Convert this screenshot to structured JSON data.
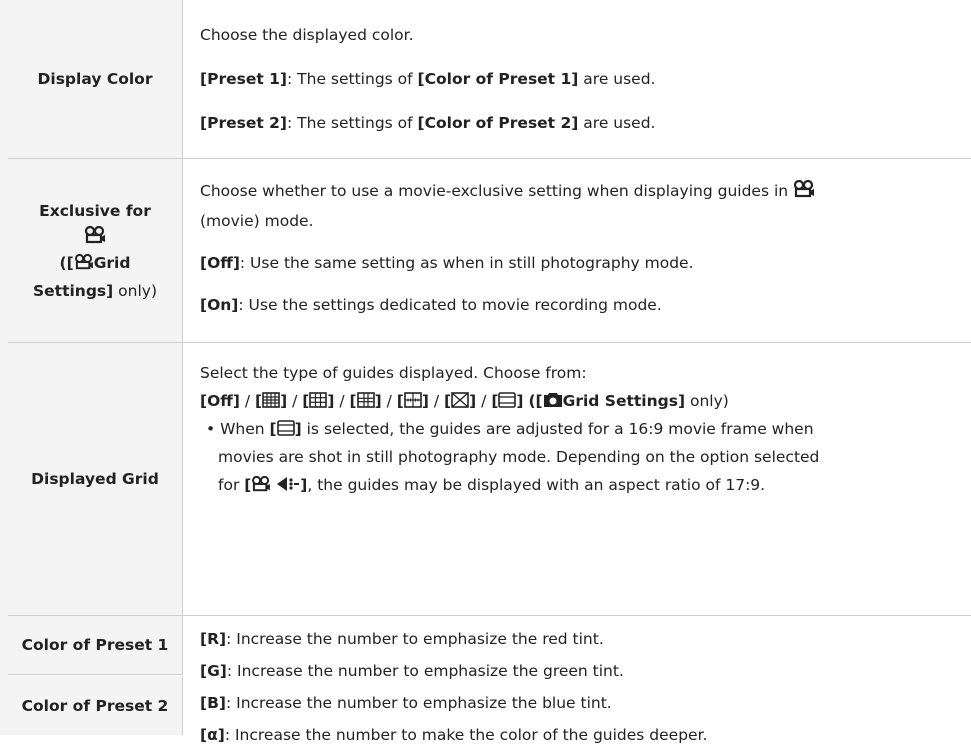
{
  "rows": {
    "display_color": {
      "label": "Display Color",
      "intro": "Choose the displayed color.",
      "opt1_key": "[Preset 1]",
      "opt1_mid": ": The settings of ",
      "opt1_ref": "[Color of Preset 1]",
      "opt1_end": " are used.",
      "opt2_key": "[Preset 2]",
      "opt2_mid": ": The settings of ",
      "opt2_ref": "[Color of Preset 2]",
      "opt2_end": " are used."
    },
    "exclusive": {
      "label_l1": "Exclusive for",
      "label_l3_pre": "([",
      "label_l3_bold": "Grid",
      "label_l4_bold": "Settings]",
      "label_l4_rest": " only)",
      "intro_l1": "Choose whether to use a movie-exclusive setting when displaying guides in",
      "intro_l2": "(movie) mode.",
      "off_key": "[Off]",
      "off_text": ": Use the same setting as when in still photography mode.",
      "on_key": "[On]",
      "on_text": ": Use the settings dedicated to movie recording mode."
    },
    "grid": {
      "label": "Displayed Grid",
      "intro": "Select the type of guides displayed. Choose from:",
      "off_key": "[Off]",
      "sep": " / ",
      "grid_settings": "Grid Settings]",
      "only": " only)",
      "bullet_pre": "When ",
      "bullet_post": " is selected, the guides are adjusted for a 16:9 movie frame when",
      "bullet_l2": "movies are shot in still photography mode. Depending on the option selected",
      "bullet_l3_pre": "for ",
      "bullet_l3_post": ", the guides may be displayed with an aspect ratio of 17:9."
    },
    "preset": {
      "label1": "Color of Preset 1",
      "label2": "Color of Preset 2",
      "r_key": "[R]",
      "r_text": ": Increase the number to emphasize the red tint.",
      "g_key": "[G]",
      "g_text": ": Increase the number to emphasize the green tint.",
      "b_key": "[B]",
      "b_text": ": Increase the number to emphasize the blue tint.",
      "a_key": "[α]",
      "a_text": ": Increase the number to make the color of the guides deeper."
    }
  }
}
